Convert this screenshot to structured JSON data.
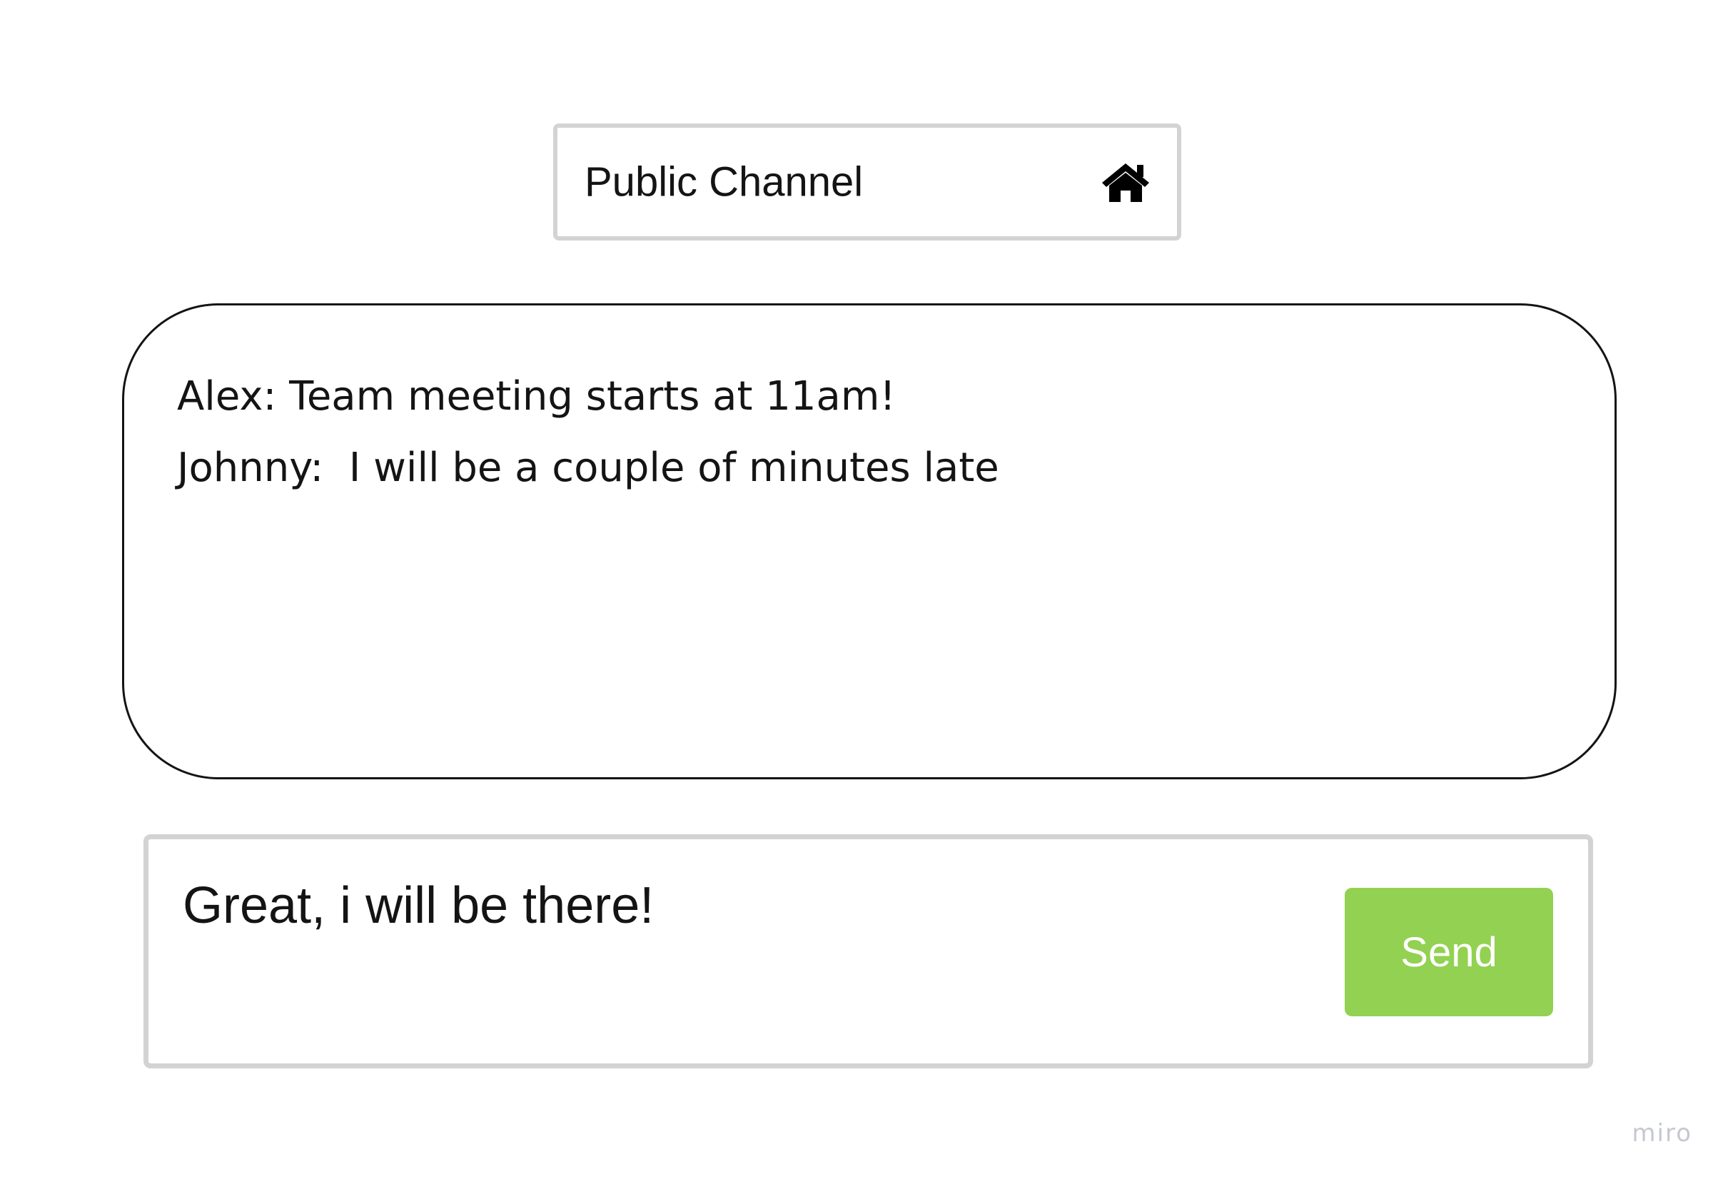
{
  "header": {
    "channel_title": "Public Channel",
    "icon": "home-icon"
  },
  "messages": [
    {
      "text": "Alex: Team meeting starts at 11am!"
    },
    {
      "text": "Johnny:  I will be a couple of minutes late"
    }
  ],
  "composer": {
    "input_value": "Great, i will be there!",
    "send_label": "Send"
  },
  "watermark": {
    "text": "miro"
  },
  "colors": {
    "send_button": "#93d152",
    "box_border": "#d3d3d3",
    "text": "#141414",
    "watermark": "#c5c8cf"
  }
}
